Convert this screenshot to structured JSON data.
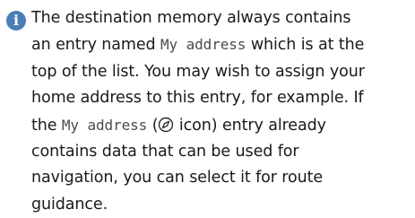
{
  "note": {
    "icon": "info-icon",
    "accent_color": "#4a7eb7",
    "line1_a": "The destination memory always contains",
    "line2_a": "an entry named ",
    "line2_code": "My address",
    "line2_b": " which is at the",
    "line3": "top of the list. You may wish to assign your",
    "line4": "home address to this entry, for example. If",
    "line5_a": "the ",
    "line5_code": "My address",
    "line5_b": " (",
    "line5_c": " icon) entry already",
    "dest_icon": "compass-icon",
    "line6": "contains data that can be used for",
    "line7": "navigation, you can select it for route",
    "line8": "guidance."
  }
}
